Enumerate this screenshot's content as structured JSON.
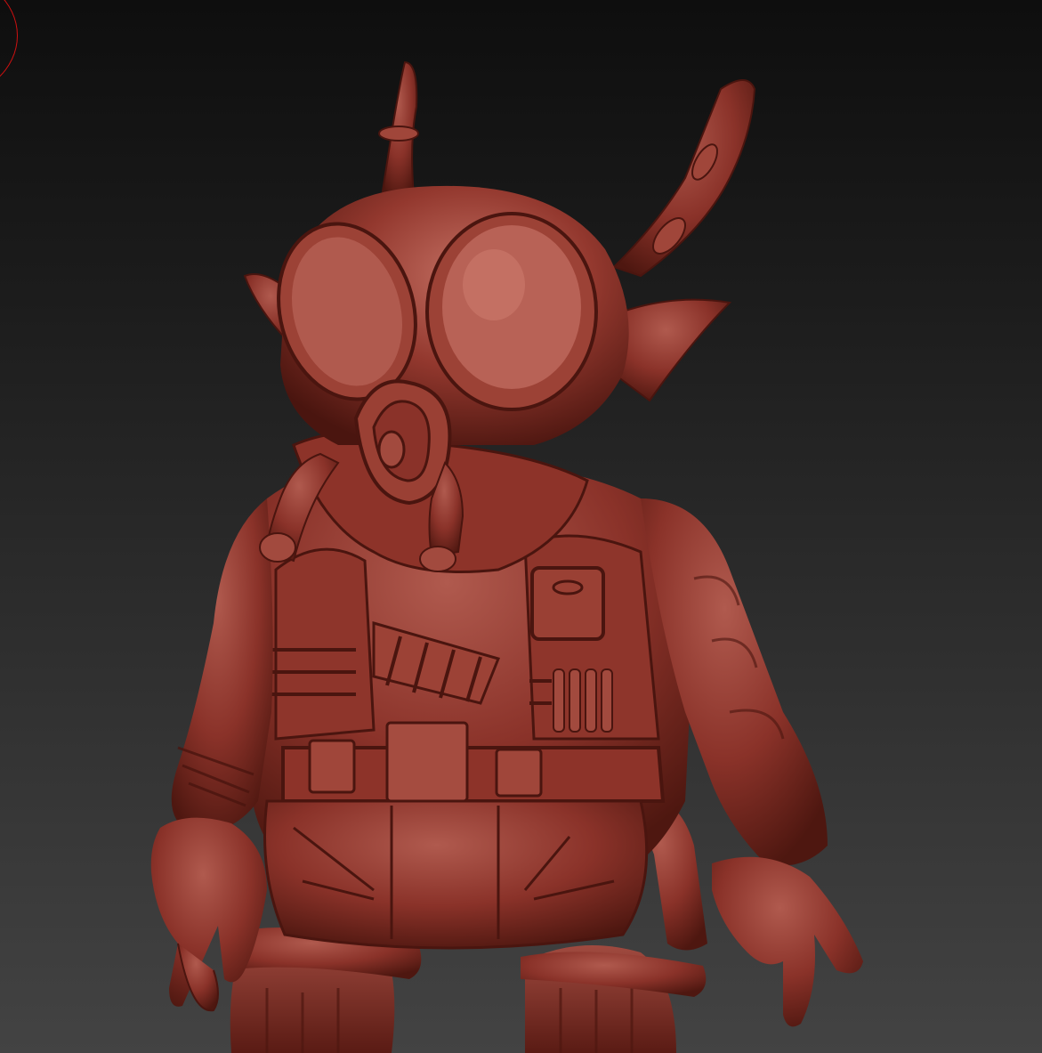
{
  "viewport": {
    "background_top": "#0e0e0e",
    "background_bottom": "#434343"
  },
  "model": {
    "material_color": "#8a3229",
    "highlight_color": "#c0685d",
    "shadow_color": "#3e110c"
  },
  "brush_cursor": {
    "color": "#d01010"
  }
}
